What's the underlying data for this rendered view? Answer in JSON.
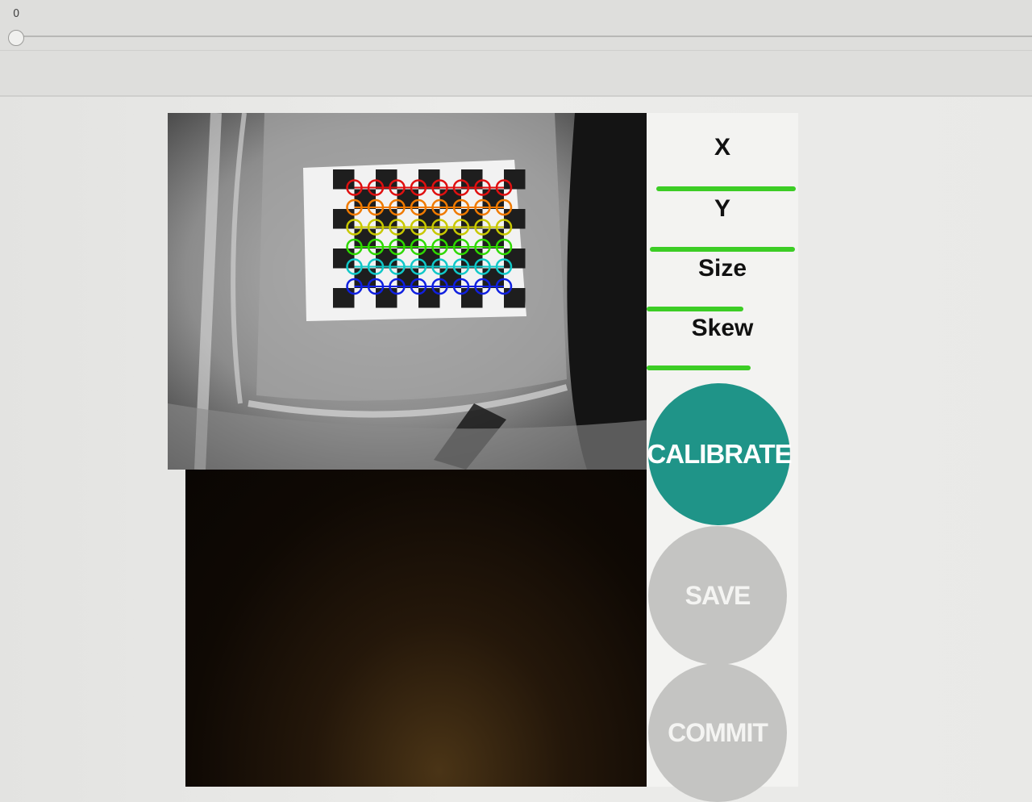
{
  "slider": {
    "value": "0",
    "position_fraction": 0.0
  },
  "metrics": [
    {
      "label": "X",
      "progress": 0.95
    },
    {
      "label": "Y",
      "progress": 0.99
    },
    {
      "label": "Size",
      "progress": 0.66
    },
    {
      "label": "Skew",
      "progress": 0.71
    }
  ],
  "buttons": {
    "calibrate": "CALIBRATE",
    "save": "SAVE",
    "commit": "COMMIT"
  },
  "colors": {
    "accent": "#1f9488",
    "disabled": "#c4c4c2",
    "progress": "#3ccd25"
  },
  "overlay_row_colors": [
    "#e01010",
    "#f07a00",
    "#c8c800",
    "#2fd800",
    "#10c8c8",
    "#1020e0"
  ]
}
